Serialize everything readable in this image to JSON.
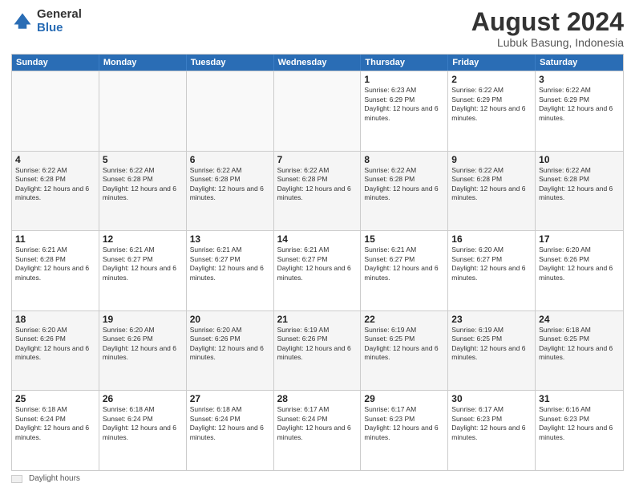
{
  "logo": {
    "general": "General",
    "blue": "Blue"
  },
  "title": "August 2024",
  "location": "Lubuk Basung, Indonesia",
  "weekdays": [
    "Sunday",
    "Monday",
    "Tuesday",
    "Wednesday",
    "Thursday",
    "Friday",
    "Saturday"
  ],
  "weeks": [
    [
      {
        "day": "",
        "info": ""
      },
      {
        "day": "",
        "info": ""
      },
      {
        "day": "",
        "info": ""
      },
      {
        "day": "",
        "info": ""
      },
      {
        "day": "1",
        "info": "Sunrise: 6:23 AM\nSunset: 6:29 PM\nDaylight: 12 hours and 6 minutes."
      },
      {
        "day": "2",
        "info": "Sunrise: 6:22 AM\nSunset: 6:29 PM\nDaylight: 12 hours and 6 minutes."
      },
      {
        "day": "3",
        "info": "Sunrise: 6:22 AM\nSunset: 6:29 PM\nDaylight: 12 hours and 6 minutes."
      }
    ],
    [
      {
        "day": "4",
        "info": "Sunrise: 6:22 AM\nSunset: 6:28 PM\nDaylight: 12 hours and 6 minutes."
      },
      {
        "day": "5",
        "info": "Sunrise: 6:22 AM\nSunset: 6:28 PM\nDaylight: 12 hours and 6 minutes."
      },
      {
        "day": "6",
        "info": "Sunrise: 6:22 AM\nSunset: 6:28 PM\nDaylight: 12 hours and 6 minutes."
      },
      {
        "day": "7",
        "info": "Sunrise: 6:22 AM\nSunset: 6:28 PM\nDaylight: 12 hours and 6 minutes."
      },
      {
        "day": "8",
        "info": "Sunrise: 6:22 AM\nSunset: 6:28 PM\nDaylight: 12 hours and 6 minutes."
      },
      {
        "day": "9",
        "info": "Sunrise: 6:22 AM\nSunset: 6:28 PM\nDaylight: 12 hours and 6 minutes."
      },
      {
        "day": "10",
        "info": "Sunrise: 6:22 AM\nSunset: 6:28 PM\nDaylight: 12 hours and 6 minutes."
      }
    ],
    [
      {
        "day": "11",
        "info": "Sunrise: 6:21 AM\nSunset: 6:28 PM\nDaylight: 12 hours and 6 minutes."
      },
      {
        "day": "12",
        "info": "Sunrise: 6:21 AM\nSunset: 6:27 PM\nDaylight: 12 hours and 6 minutes."
      },
      {
        "day": "13",
        "info": "Sunrise: 6:21 AM\nSunset: 6:27 PM\nDaylight: 12 hours and 6 minutes."
      },
      {
        "day": "14",
        "info": "Sunrise: 6:21 AM\nSunset: 6:27 PM\nDaylight: 12 hours and 6 minutes."
      },
      {
        "day": "15",
        "info": "Sunrise: 6:21 AM\nSunset: 6:27 PM\nDaylight: 12 hours and 6 minutes."
      },
      {
        "day": "16",
        "info": "Sunrise: 6:20 AM\nSunset: 6:27 PM\nDaylight: 12 hours and 6 minutes."
      },
      {
        "day": "17",
        "info": "Sunrise: 6:20 AM\nSunset: 6:26 PM\nDaylight: 12 hours and 6 minutes."
      }
    ],
    [
      {
        "day": "18",
        "info": "Sunrise: 6:20 AM\nSunset: 6:26 PM\nDaylight: 12 hours and 6 minutes."
      },
      {
        "day": "19",
        "info": "Sunrise: 6:20 AM\nSunset: 6:26 PM\nDaylight: 12 hours and 6 minutes."
      },
      {
        "day": "20",
        "info": "Sunrise: 6:20 AM\nSunset: 6:26 PM\nDaylight: 12 hours and 6 minutes."
      },
      {
        "day": "21",
        "info": "Sunrise: 6:19 AM\nSunset: 6:26 PM\nDaylight: 12 hours and 6 minutes."
      },
      {
        "day": "22",
        "info": "Sunrise: 6:19 AM\nSunset: 6:25 PM\nDaylight: 12 hours and 6 minutes."
      },
      {
        "day": "23",
        "info": "Sunrise: 6:19 AM\nSunset: 6:25 PM\nDaylight: 12 hours and 6 minutes."
      },
      {
        "day": "24",
        "info": "Sunrise: 6:18 AM\nSunset: 6:25 PM\nDaylight: 12 hours and 6 minutes."
      }
    ],
    [
      {
        "day": "25",
        "info": "Sunrise: 6:18 AM\nSunset: 6:24 PM\nDaylight: 12 hours and 6 minutes."
      },
      {
        "day": "26",
        "info": "Sunrise: 6:18 AM\nSunset: 6:24 PM\nDaylight: 12 hours and 6 minutes."
      },
      {
        "day": "27",
        "info": "Sunrise: 6:18 AM\nSunset: 6:24 PM\nDaylight: 12 hours and 6 minutes."
      },
      {
        "day": "28",
        "info": "Sunrise: 6:17 AM\nSunset: 6:24 PM\nDaylight: 12 hours and 6 minutes."
      },
      {
        "day": "29",
        "info": "Sunrise: 6:17 AM\nSunset: 6:23 PM\nDaylight: 12 hours and 6 minutes."
      },
      {
        "day": "30",
        "info": "Sunrise: 6:17 AM\nSunset: 6:23 PM\nDaylight: 12 hours and 6 minutes."
      },
      {
        "day": "31",
        "info": "Sunrise: 6:16 AM\nSunset: 6:23 PM\nDaylight: 12 hours and 6 minutes."
      }
    ]
  ],
  "legend": {
    "box_label": "Daylight hours"
  }
}
